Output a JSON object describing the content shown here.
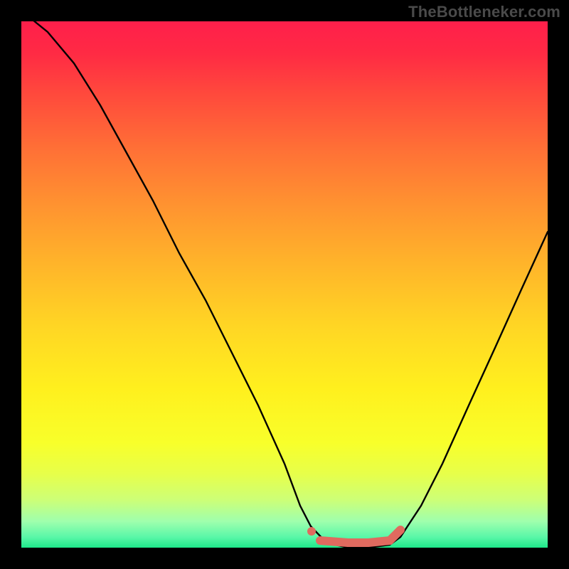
{
  "watermark": "TheBottleneker.com",
  "chart_data": {
    "type": "line",
    "title": "",
    "xlabel": "",
    "ylabel": "",
    "xlim": [
      0,
      100
    ],
    "ylim": [
      0,
      100
    ],
    "series": [
      {
        "name": "bottleneck-curve",
        "x": [
          0,
          5,
          10,
          15,
          20,
          25,
          30,
          35,
          40,
          45,
          50,
          53,
          55,
          58,
          62,
          66,
          70,
          72,
          76,
          80,
          85,
          90,
          95,
          100
        ],
        "y": [
          102,
          98,
          92,
          84,
          75,
          66,
          56,
          47,
          37,
          27,
          16,
          8,
          4,
          1,
          0,
          0,
          0.5,
          2,
          8,
          16,
          27,
          38,
          49,
          60
        ]
      },
      {
        "name": "optimal-range-marker",
        "x": [
          55,
          58,
          62,
          66,
          70,
          72
        ],
        "y": [
          2.2,
          1.2,
          1.0,
          1.0,
          1.4,
          2.8
        ]
      }
    ],
    "colors": {
      "curve": "#000000",
      "marker": "#e06a5f",
      "gradient_top": "#ff1f4b",
      "gradient_bottom": "#1ee88a"
    }
  }
}
